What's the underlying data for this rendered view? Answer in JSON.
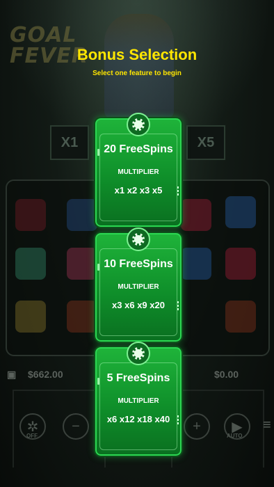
{
  "background": {
    "logo_text": "GOAL FEVER",
    "multipliers": [
      "X1",
      "X5"
    ],
    "balance": "$662.00",
    "win": "$0.00",
    "controls": {
      "turbo_label": "OFF",
      "minus": "−",
      "plus": "+",
      "auto_label": "AUTO",
      "menu": "≡"
    }
  },
  "dialog": {
    "title": "Bonus Selection",
    "subtitle": "Select one feature to begin"
  },
  "options": [
    {
      "spins": "20 FreeSpins",
      "multiplier_label": "MULTIPLIER",
      "multipliers": "x1 x2 x3 x5"
    },
    {
      "spins": "10 FreeSpins",
      "multiplier_label": "MULTIPLIER",
      "multipliers": "x3 x6 x9 x20"
    },
    {
      "spins": "5 FreeSpins",
      "multiplier_label": "MULTIPLIER",
      "multipliers": "x6 x12 x18 x40"
    }
  ],
  "colors": {
    "title": "#ffe600",
    "card_green": "#1fb43a",
    "backdrop": "#0b100d"
  }
}
